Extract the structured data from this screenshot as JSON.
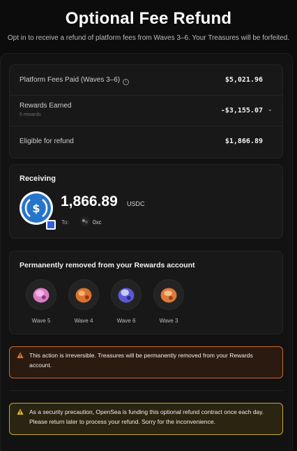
{
  "header": {
    "title": "Optional Fee Refund",
    "subtitle": "Opt in to receive a refund of platform fees from Waves 3–6. Your Treasures will be forfeited."
  },
  "fees": {
    "platform_label": "Platform Fees Paid (Waves 3–6)",
    "platform_value": "$5,021.96",
    "rewards_label": "Rewards Earned",
    "rewards_sub": "5 rewards",
    "rewards_value": "-$3,155.07",
    "eligible_label": "Eligible for refund",
    "eligible_value": "$1,866.89"
  },
  "receiving": {
    "label": "Receiving",
    "amount": "1,866.89",
    "currency": "USDC",
    "to_label": "To:",
    "to_name": "0xc"
  },
  "treasures": {
    "label": "Permanently removed from your Rewards account",
    "items": [
      {
        "label": "Wave 5"
      },
      {
        "label": "Wave 4"
      },
      {
        "label": "Wave 6"
      },
      {
        "label": "Wave 3"
      }
    ]
  },
  "warnings": {
    "irreversible": "This action is irreversible. Treasures will be permanently removed from your Rewards account.",
    "security": "As a security precaution, OpenSea is funding this optional refund contract once each day. Please return later to process your refund. Sorry for the inconvenience."
  },
  "icons": {
    "info": "info-icon",
    "chevron": "chevron-down-icon",
    "usdc": "usdc-logo-icon",
    "warning": "warning-triangle-icon"
  },
  "colors": {
    "background": "#0c0c0c",
    "warning_orange": "#c86a2a",
    "warning_yellow": "#c9a62a",
    "usdc_blue": "#2775ca"
  }
}
